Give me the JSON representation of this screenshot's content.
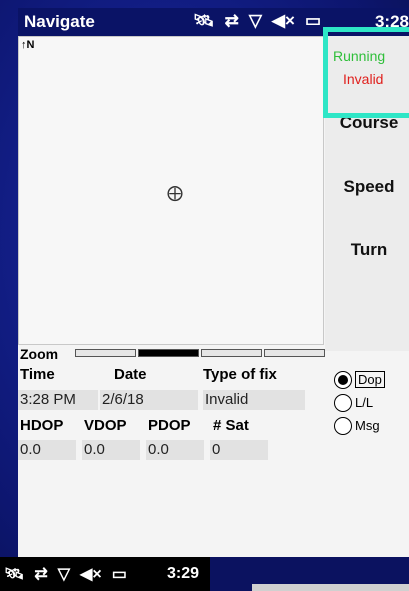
{
  "titlebar": {
    "title": "Navigate",
    "clock": "3:28"
  },
  "map": {
    "north_label": "↑N"
  },
  "side": {
    "running": "Running",
    "invalid": "Invalid",
    "course": "Course",
    "speed": "Speed",
    "turn": "Turn",
    "colors": {
      "running": "#2fbf3a",
      "invalid": "#e0201d"
    }
  },
  "zoom": {
    "label": "Zoom",
    "active_segment": 2,
    "segments": 5
  },
  "fix": {
    "labels": {
      "time": "Time",
      "date": "Date",
      "type": "Type of fix"
    },
    "values": {
      "time": "3:28 PM",
      "date": "2/6/18",
      "type": "Invalid"
    }
  },
  "dop": {
    "labels": {
      "hdop": "HDOP",
      "vdop": "VDOP",
      "pdop": "PDOP",
      "sat": "# Sat"
    },
    "values": {
      "hdop": "0.0",
      "vdop": "0.0",
      "pdop": "0.0",
      "sat": "0"
    }
  },
  "radio_options": [
    {
      "label": "Dop",
      "checked": true
    },
    {
      "label": "L/L",
      "checked": false
    },
    {
      "label": "Msg",
      "checked": false
    }
  ],
  "taskbar": {
    "time": "3:29"
  },
  "icons": [
    "satellite-icon",
    "sync-icon",
    "no-signal-icon",
    "volume-muted-icon",
    "battery-icon"
  ]
}
